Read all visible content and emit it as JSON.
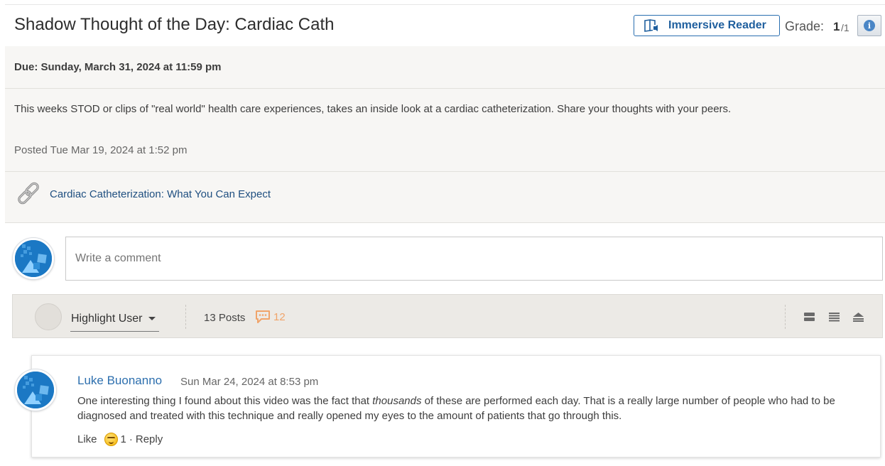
{
  "header": {
    "title": "Shadow Thought of the Day: Cardiac Cath",
    "immersive_reader": "Immersive Reader",
    "grade_label": "Grade:",
    "grade_value": "1",
    "grade_out_of": "/1"
  },
  "topic": {
    "due": "Due: Sunday, March 31, 2024 at 11:59 pm",
    "description": "This weeks STOD or clips of \"real world\" health care experiences, takes an inside look at a cardiac catheterization. Share your thoughts with your peers.",
    "posted": "Posted Tue Mar 19, 2024 at 1:52 pm",
    "link_text": "Cardiac Catheterization: What You Can Expect"
  },
  "composer": {
    "placeholder": "Write a comment"
  },
  "toolbar": {
    "highlight_user": "Highlight User",
    "posts_count": "13 Posts",
    "unread_count": "12"
  },
  "reply": {
    "author": "Luke Buonanno",
    "timestamp": "Sun Mar 24, 2024 at 8:53 pm",
    "text_before": "One interesting thing I found about this video was the fact that ",
    "text_emphasis": "thousands",
    "text_after": " of these are performed each day. That is a really large number of people who had to be diagnosed and treated with this technique and really opened my eyes to the amount of patients that go through this.",
    "like_label": "Like",
    "reaction_count": "1",
    "separator": "·",
    "reply_label": "Reply"
  },
  "colors": {
    "accent": "#1f5f9e",
    "author_link": "#2d6fae",
    "unread": "#f0a46a",
    "avatar_blue": "#1b78c4"
  }
}
